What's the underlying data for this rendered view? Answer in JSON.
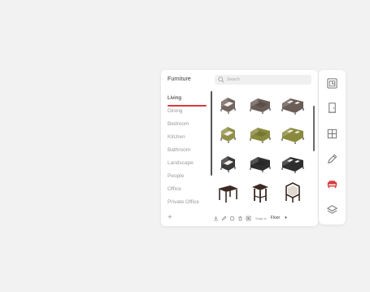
{
  "library": {
    "title": "Furniture",
    "search": {
      "placeholder": "Search"
    },
    "categories": [
      {
        "label": "Living"
      },
      {
        "label": "Dining"
      },
      {
        "label": "Bedroom"
      },
      {
        "label": "Kitchen"
      },
      {
        "label": "Bathroom"
      },
      {
        "label": "Landscape"
      },
      {
        "label": "People"
      },
      {
        "label": "Office"
      },
      {
        "label": "Private Office"
      }
    ],
    "add_label": "+",
    "items": [
      {
        "icon": "armchair-icon",
        "color": "#6b5d57"
      },
      {
        "icon": "loveseat-icon",
        "color": "#6b5d57"
      },
      {
        "icon": "sofa-icon",
        "color": "#6b5d57"
      },
      {
        "icon": "armchair-icon",
        "color": "#8a8a3e"
      },
      {
        "icon": "loveseat-icon",
        "color": "#8a8a3e"
      },
      {
        "icon": "sofa-icon",
        "color": "#8a8a3e"
      },
      {
        "icon": "armchair-icon",
        "color": "#2e2e2e"
      },
      {
        "icon": "loveseat-icon",
        "color": "#2e2e2e"
      },
      {
        "icon": "sofa-icon",
        "color": "#2e2e2e"
      },
      {
        "icon": "table-icon",
        "color": "#3a2a22"
      },
      {
        "icon": "side-table-icon",
        "color": "#3a2a22"
      },
      {
        "icon": "chair-icon",
        "color": "#3a2a22"
      }
    ],
    "bottom_bar": {
      "snap_label": "Snap to",
      "snap_value": "Floor"
    }
  },
  "colors": {
    "accent": "#d93b3b",
    "text_muted": "#9a9a9a"
  },
  "toolbar": {
    "tools": [
      {
        "name": "floorplan-icon"
      },
      {
        "name": "door-icon"
      },
      {
        "name": "window-icon"
      },
      {
        "name": "pencil-icon"
      },
      {
        "name": "furniture-icon",
        "active_color": "#d93b3b"
      },
      {
        "name": "layers-icon"
      }
    ]
  }
}
